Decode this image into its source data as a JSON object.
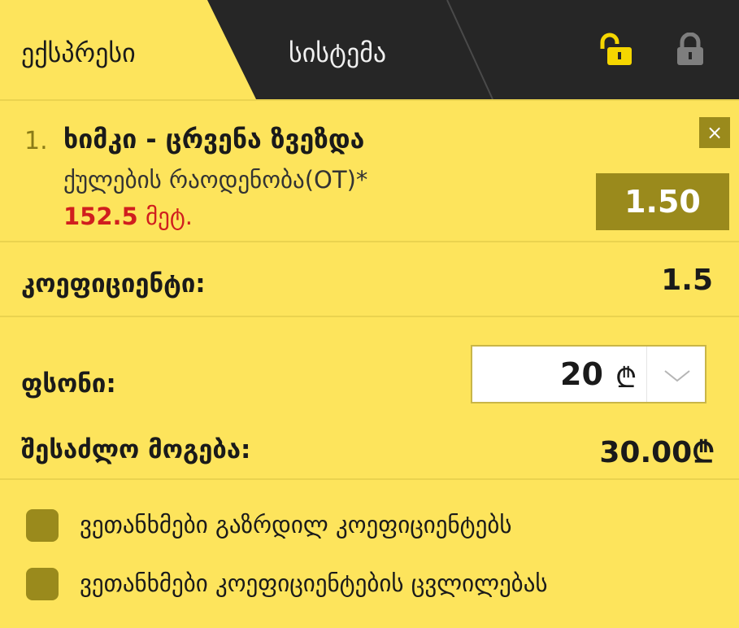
{
  "tabs": {
    "express": "ექსპრესი",
    "system": "სისტემა"
  },
  "icons": {
    "lock_open": "unlock-icon",
    "lock_closed": "lock-icon",
    "close": "close-icon",
    "dropdown": "chevron-down-icon"
  },
  "colors": {
    "accent": "#fde45c",
    "dark": "#262626",
    "button": "#9a8a1c",
    "highlight": "#d01e1e"
  },
  "bet": {
    "number": "1.",
    "match": "ხიმკი - ცრვენა ზვეზდა",
    "market": "ქულების რაოდენობა(OT)*",
    "selection_value": "152.5",
    "selection_unit": "მეტ.",
    "odd": "1.50",
    "close_symbol": "×"
  },
  "coefficient": {
    "label": "კოეფიციენტი:",
    "value": "1.5"
  },
  "stake": {
    "label": "ფსონი:",
    "value": "20",
    "currency": "₾"
  },
  "win": {
    "label": "შესაძლო მოგება:",
    "value": "30.00₾"
  },
  "options": [
    "ვეთანხმები გაზრდილ კოეფიციენტებს",
    "ვეთანხმები კოეფიციენტების ცვლილებას"
  ]
}
